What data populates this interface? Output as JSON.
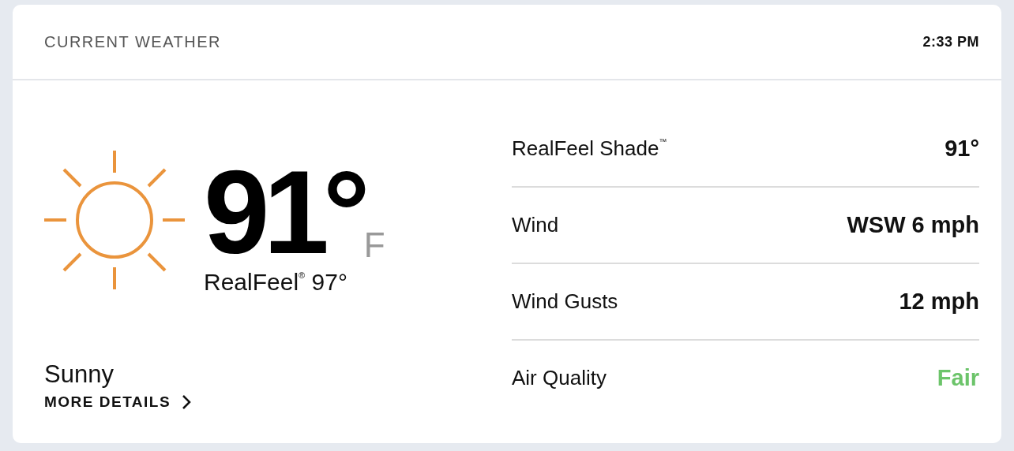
{
  "header": {
    "title": "CURRENT WEATHER",
    "time": "2:33 PM"
  },
  "current": {
    "temperature": "91°",
    "unit": "F",
    "realfeel": "RealFeel$^{®}$ 97°",
    "condition": "Sunny",
    "more_link": "MORE DETAILS"
  },
  "details": [
    {
      "label": "RealFeel Shade$^{™}$",
      "value": "91°"
    },
    {
      "label": "Wind",
      "value": "WSW 6 mph"
    },
    {
      "label": "Wind Gusts",
      "value": "12 mph"
    },
    {
      "label": "Air Quality",
      "value": "Fair",
      "color": "#6cc46a"
    }
  ]
}
